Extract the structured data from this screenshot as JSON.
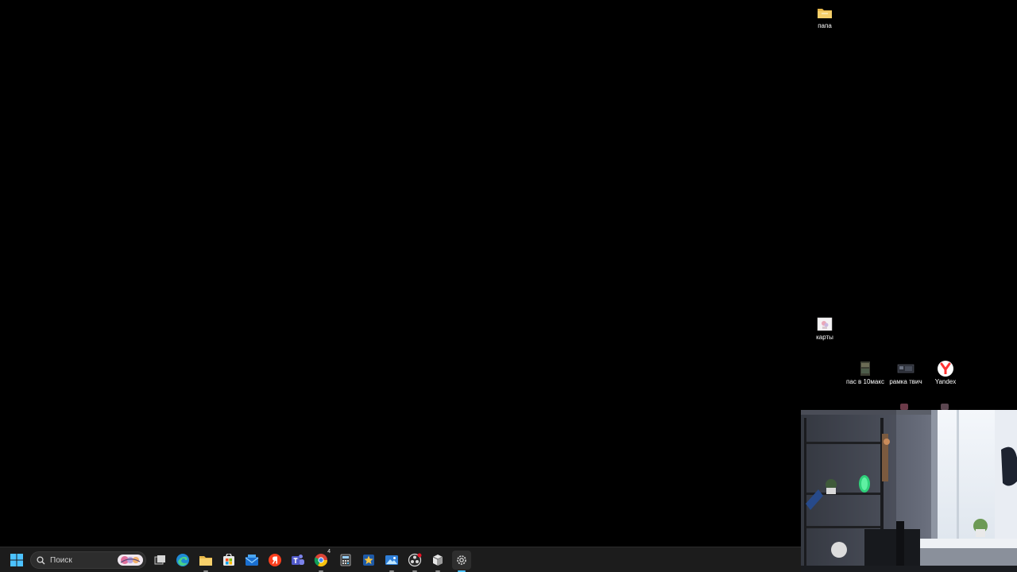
{
  "desktop": {
    "background_color": "#000000",
    "icons": [
      {
        "id": "papa",
        "label": "папа",
        "icon": "folder-icon"
      },
      {
        "id": "karty",
        "label": "карты",
        "icon": "image-file-icon"
      },
      {
        "id": "pas",
        "label": "пас в 10макс",
        "icon": "video-file-icon"
      },
      {
        "id": "ramka",
        "label": "рамка твич",
        "icon": "image-file-icon"
      },
      {
        "id": "yandex",
        "label": "Yandex",
        "icon": "yandex-browser-icon"
      }
    ]
  },
  "webcam": {
    "description_icon": "webcam-feed"
  },
  "taskbar": {
    "search_placeholder": "Поиск",
    "colors": {
      "background": "#1c1c1c",
      "accent": "#4cc2ff"
    },
    "apps": [
      {
        "name": "start-button",
        "icon": "windows-logo-icon"
      },
      {
        "name": "task-view",
        "icon": "task-view-icon"
      },
      {
        "name": "edge",
        "icon": "edge-icon"
      },
      {
        "name": "file-explorer",
        "icon": "folder-icon"
      },
      {
        "name": "store",
        "icon": "store-icon"
      },
      {
        "name": "mail",
        "icon": "mail-icon"
      },
      {
        "name": "yandex",
        "icon": "yandex-icon"
      },
      {
        "name": "teams",
        "icon": "teams-icon"
      },
      {
        "name": "chrome",
        "icon": "chrome-icon",
        "badge": "4"
      },
      {
        "name": "calculator",
        "icon": "calculator-icon"
      },
      {
        "name": "star-app",
        "icon": "star-icon"
      },
      {
        "name": "photos",
        "icon": "photos-icon"
      },
      {
        "name": "obs",
        "icon": "obs-icon"
      },
      {
        "name": "box-app",
        "icon": "box-icon"
      },
      {
        "name": "settings",
        "icon": "gear-icon"
      }
    ]
  }
}
